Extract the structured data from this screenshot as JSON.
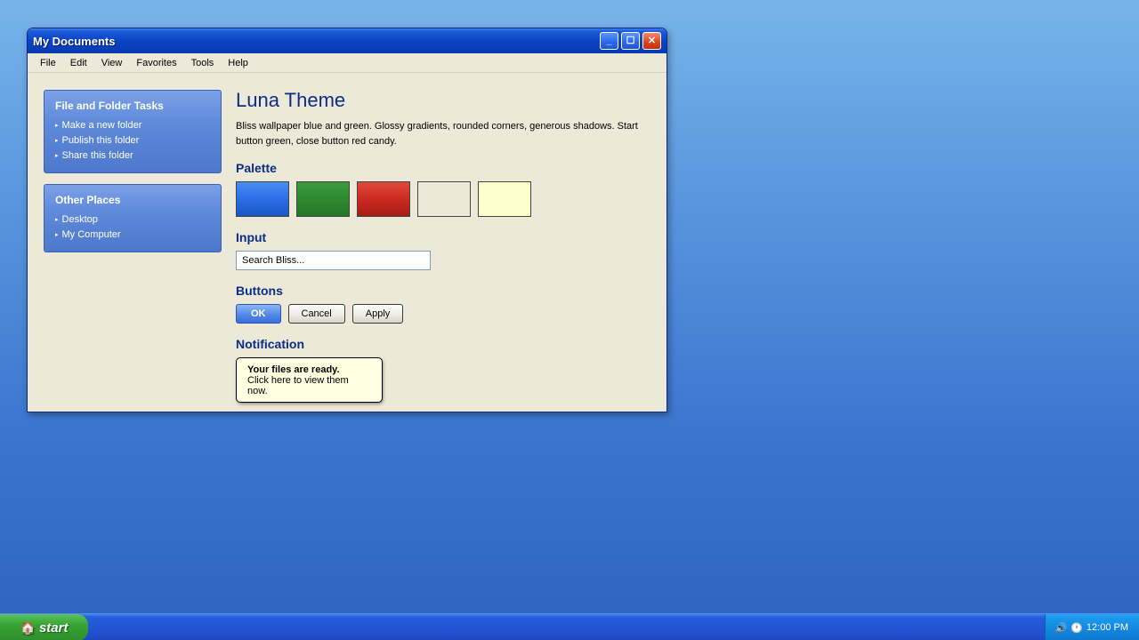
{
  "window": {
    "title": "My Documents",
    "minimize_label": "_",
    "maximize_label": "☐",
    "close_label": "✕"
  },
  "menu": [
    "File",
    "Edit",
    "View",
    "Favorites",
    "Tools",
    "Help"
  ],
  "sidebar": {
    "panels": [
      {
        "title": "File and Folder Tasks",
        "items": [
          "Make a new folder",
          "Publish this folder",
          "Share this folder"
        ]
      },
      {
        "title": "Other Places",
        "items": [
          "Desktop",
          "My Computer"
        ]
      }
    ],
    "bullet": "▸"
  },
  "main": {
    "title": "Luna Theme",
    "description": "Bliss wallpaper blue and green. Glossy gradients, rounded corners, generous shadows. Start button green, close button red candy.",
    "palette_heading": "Palette",
    "palette": [
      {
        "name": "swatch-blue",
        "color": "#2b6ee6"
      },
      {
        "name": "swatch-green",
        "color": "#2e8a2e"
      },
      {
        "name": "swatch-red",
        "color": "#c8281e"
      },
      {
        "name": "swatch-beige",
        "color": "#ece9d8"
      },
      {
        "name": "swatch-cream",
        "color": "#ffffcc"
      }
    ],
    "input_heading": "Input",
    "search_value": "Search Bliss...",
    "buttons_heading": "Buttons",
    "buttons": {
      "ok": "OK",
      "cancel": "Cancel",
      "apply": "Apply"
    },
    "notification_heading": "Notification",
    "notification": {
      "line1": "Your files are ready.",
      "line2": "Click here to view them now."
    }
  },
  "taskbar": {
    "start_label": "start",
    "start_icon": "🏠",
    "tray_icons": [
      "🔊",
      "🕐"
    ],
    "clock": "12:00 PM"
  },
  "colors": {
    "accent": "#0a2d86",
    "window_bg": "#ece9d8",
    "titlebar": "#0b43c4",
    "start_green": "#36a335",
    "close_red": "#d9431e"
  }
}
